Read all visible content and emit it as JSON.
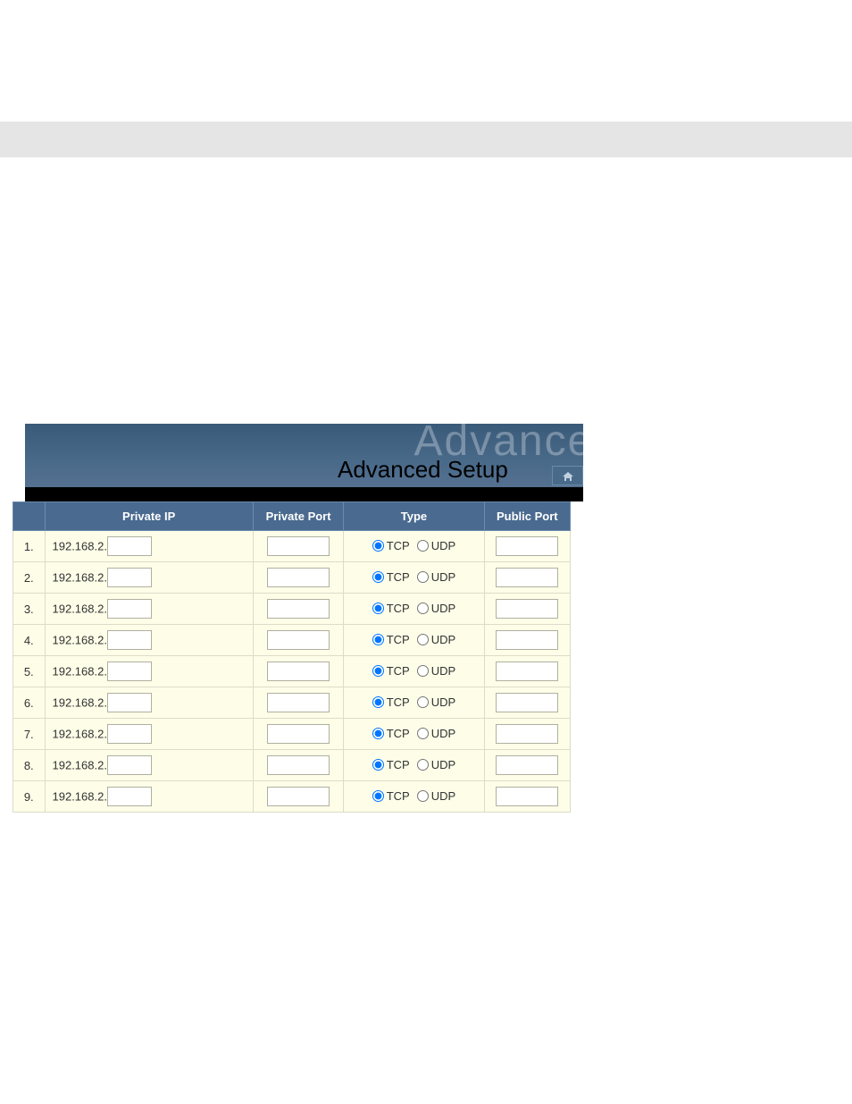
{
  "banner": {
    "watermark": "Advanced",
    "title": "Advanced Setup"
  },
  "table": {
    "headers": {
      "rownum": "",
      "private_ip": "Private IP",
      "private_port": "Private Port",
      "type": "Type",
      "public_port": "Public Port"
    },
    "ip_prefix": "192.168.2.",
    "type_options": {
      "tcp": "TCP",
      "udp": "UDP"
    },
    "rows": [
      {
        "num": "1.",
        "ip_suffix": "",
        "private_port": "",
        "type": "tcp",
        "public_port": ""
      },
      {
        "num": "2.",
        "ip_suffix": "",
        "private_port": "",
        "type": "tcp",
        "public_port": ""
      },
      {
        "num": "3.",
        "ip_suffix": "",
        "private_port": "",
        "type": "tcp",
        "public_port": ""
      },
      {
        "num": "4.",
        "ip_suffix": "",
        "private_port": "",
        "type": "tcp",
        "public_port": ""
      },
      {
        "num": "5.",
        "ip_suffix": "",
        "private_port": "",
        "type": "tcp",
        "public_port": ""
      },
      {
        "num": "6.",
        "ip_suffix": "",
        "private_port": "",
        "type": "tcp",
        "public_port": ""
      },
      {
        "num": "7.",
        "ip_suffix": "",
        "private_port": "",
        "type": "tcp",
        "public_port": ""
      },
      {
        "num": "8.",
        "ip_suffix": "",
        "private_port": "",
        "type": "tcp",
        "public_port": ""
      },
      {
        "num": "9.",
        "ip_suffix": "",
        "private_port": "",
        "type": "tcp",
        "public_port": ""
      }
    ]
  }
}
